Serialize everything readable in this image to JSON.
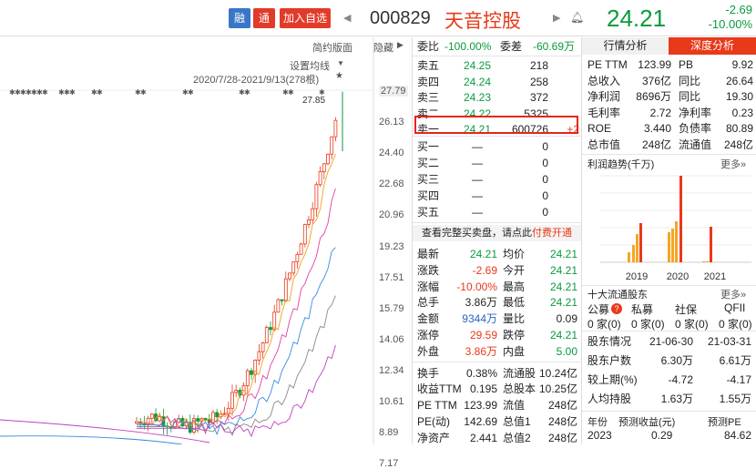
{
  "header": {
    "rong": "融",
    "tong": "通",
    "add": "加入自选",
    "code": "000829",
    "name": "天音控股",
    "price": "24.21",
    "change": "-2.69",
    "pct": "-10.00%"
  },
  "chart": {
    "toolbar1": "简约版面",
    "toolbar2": "隐藏",
    "ma_setting": "设置均线",
    "range": "2020/7/28-2021/9/13(278根)",
    "max_label": "27.85",
    "yticks": [
      "27.79",
      "26.13",
      "24.40",
      "22.68",
      "20.96",
      "19.23",
      "17.51",
      "15.79",
      "14.06",
      "12.34",
      "10.61",
      "8.89",
      "7.17"
    ]
  },
  "orderbook": {
    "wb_label": "委比",
    "wb": "-100.00%",
    "wc_label": "委差",
    "wc": "-60.69万",
    "asks": [
      {
        "l": "卖五",
        "p": "24.25",
        "v": "218"
      },
      {
        "l": "卖四",
        "p": "24.24",
        "v": "258"
      },
      {
        "l": "卖三",
        "p": "24.23",
        "v": "372"
      },
      {
        "l": "卖二",
        "p": "24.22",
        "v": "5325"
      },
      {
        "l": "卖一",
        "p": "24.21",
        "v": "600726",
        "d": "+2"
      }
    ],
    "bids": [
      {
        "l": "买一",
        "p": "—",
        "v": "0"
      },
      {
        "l": "买二",
        "p": "—",
        "v": "0"
      },
      {
        "l": "买三",
        "p": "—",
        "v": "0"
      },
      {
        "l": "买四",
        "p": "—",
        "v": "0"
      },
      {
        "l": "买五",
        "p": "—",
        "v": "0"
      }
    ],
    "notice": "查看完整买卖盘，请点此",
    "notice_link": "付费开通"
  },
  "quote": [
    [
      "最新",
      "24.21",
      "均价",
      "24.21"
    ],
    [
      "涨跌",
      "-2.69",
      "今开",
      "24.21"
    ],
    [
      "涨幅",
      "-10.00%",
      "最高",
      "24.21"
    ],
    [
      "总手",
      "3.86万",
      "最低",
      "24.21"
    ],
    [
      "金额",
      "9344万",
      "量比",
      "0.09"
    ],
    [
      "涨停",
      "29.59",
      "跌停",
      "24.21"
    ],
    [
      "外盘",
      "3.86万",
      "内盘",
      "5.00"
    ],
    [
      "换手",
      "0.38%",
      "流通股",
      "10.24亿"
    ],
    [
      "收益TTM",
      "0.195",
      "总股本",
      "10.25亿"
    ],
    [
      "PE TTM",
      "123.99",
      "流值",
      "248亿"
    ],
    [
      "PE(动)",
      "142.69",
      "总值1",
      "248亿"
    ],
    [
      "净资产",
      "2.441",
      "总值2",
      "248亿"
    ]
  ],
  "right": {
    "tab1": "行情分析",
    "tab2": "深度分析",
    "fin": [
      [
        "PE TTM",
        "123.99",
        "PB",
        "9.92"
      ],
      [
        "总收入",
        "376亿",
        "同比",
        "26.64"
      ],
      [
        "净利润",
        "8696万",
        "同比",
        "19.30"
      ],
      [
        "毛利率",
        "2.72",
        "净利率",
        "0.23"
      ],
      [
        "ROE",
        "3.440",
        "负债率",
        "80.89"
      ],
      [
        "总市值",
        "248亿",
        "流通值",
        "248亿"
      ]
    ],
    "profit_title": "利润趋势(千万)",
    "more": "更多»",
    "years": [
      "2019",
      "2020",
      "2021"
    ],
    "holders_title": "十大流通股东",
    "holder_types": [
      "公募",
      "私募",
      "社保",
      "QFII"
    ],
    "holder_counts": [
      "0 家(0)",
      "0 家(0)",
      "0 家(0)",
      "0 家(0)"
    ],
    "hinfo": [
      [
        "股东情况",
        "21-06-30",
        "21-03-31"
      ],
      [
        "股东户数",
        "6.30万",
        "6.61万"
      ],
      [
        "较上期(%)",
        "-4.72",
        "-4.17"
      ],
      [
        "人均持股",
        "1.63万",
        "1.55万"
      ]
    ],
    "fc_head": [
      "年份",
      "预测收益(元)",
      "预测PE"
    ],
    "fc_row": [
      "2023",
      "0.29",
      "84.62"
    ]
  }
}
